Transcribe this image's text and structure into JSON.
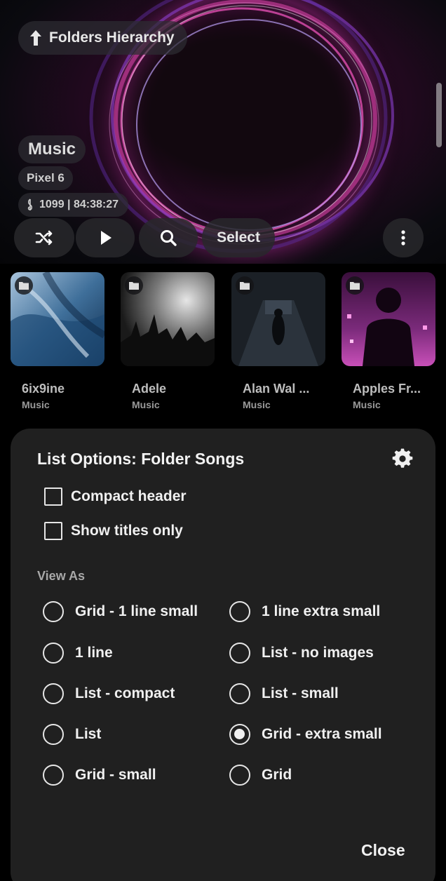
{
  "header": {
    "folders_hierarchy_label": "Folders Hierarchy",
    "title": "Music",
    "device": "Pixel 6",
    "stats": "1099 | 84:38:27",
    "select_label": "Select"
  },
  "folders": [
    {
      "name": "6ix9ine",
      "subtitle": "Music"
    },
    {
      "name": "Adele",
      "subtitle": "Music"
    },
    {
      "name": "Alan Wal ...",
      "subtitle": "Music"
    },
    {
      "name": "Apples Fr...",
      "subtitle": "Music"
    }
  ],
  "sheet": {
    "title": "List Options: Folder Songs",
    "checkboxes": [
      {
        "label": "Compact header",
        "checked": false
      },
      {
        "label": "Show titles only",
        "checked": false
      }
    ],
    "view_as_label": "View As",
    "options": [
      "Grid - 1 line small",
      "1 line extra small",
      "1 line",
      "List - no images",
      "List - compact",
      "List - small",
      "List",
      "Grid - extra small",
      "Grid - small",
      "Grid"
    ],
    "selected_option": "Grid - extra small",
    "close_label": "Close"
  },
  "colors": {
    "sheet_bg": "#202020",
    "accent_ring_pink": "#d43c9e",
    "accent_ring_violet": "#9b7ef0"
  },
  "icons": [
    "arrow-up-icon",
    "treble-clef-icon",
    "shuffle-icon",
    "play-icon",
    "search-icon",
    "more-vertical-icon",
    "folder-icon",
    "gear-icon"
  ]
}
